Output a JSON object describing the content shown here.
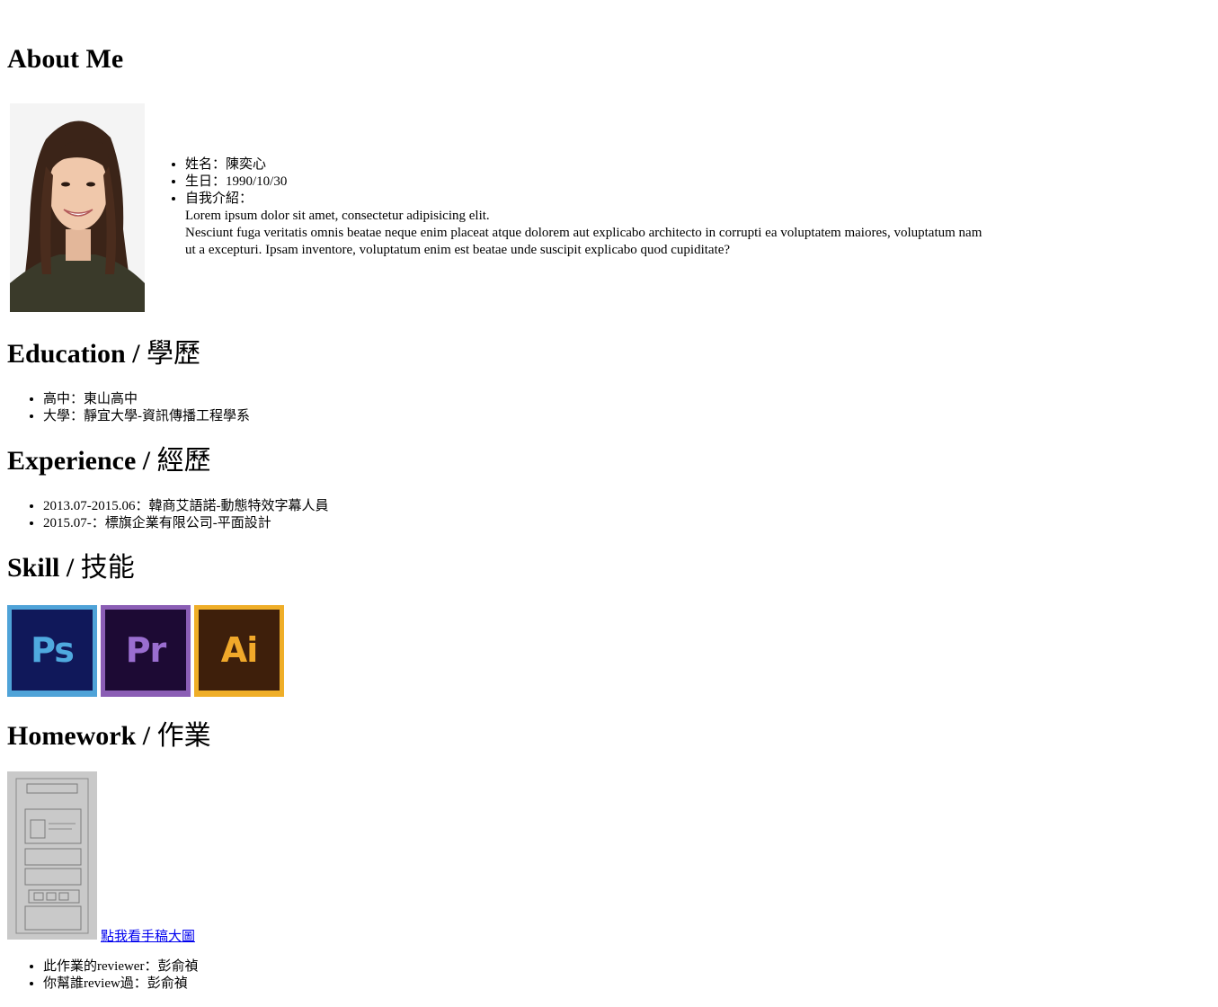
{
  "about": {
    "heading": "About Me",
    "items": {
      "name": "姓名：陳奕心",
      "birthday": "生日：1990/10/30",
      "intro_label": "自我介紹：",
      "intro_line1": "Lorem ipsum dolor sit amet, consectetur adipisicing elit.",
      "intro_line2": "Nesciunt fuga veritatis omnis beatae neque enim placeat atque dolorem aut explicabo architecto in corrupti ea voluptatem maiores, voluptatum nam ut a excepturi. Ipsam inventore, voluptatum enim est beatae unde suscipit explicabo quod cupiditate?"
    }
  },
  "education": {
    "heading_en": "Education / ",
    "heading_zh": "學歷",
    "items": [
      "高中：東山高中",
      "大學：靜宜大學-資訊傳播工程學系"
    ]
  },
  "experience": {
    "heading_en": "Experience / ",
    "heading_zh": "經歷",
    "items": [
      "2013.07-2015.06：韓商艾語諾-動態特效字幕人員",
      "2015.07-：標旗企業有限公司-平面設計"
    ]
  },
  "skill": {
    "heading_en": "Skill / ",
    "heading_zh": "技能",
    "icons": [
      {
        "label": "Ps",
        "icon": "photoshop-icon",
        "border": "#4fa3d8",
        "bg": "#10185a",
        "text": "#4fa9df"
      },
      {
        "label": "Pr",
        "icon": "premiere-icon",
        "border": "#8b5eb5",
        "bg": "#1d0a34",
        "text": "#9a6ed0"
      },
      {
        "label": "Ai",
        "icon": "illustrator-icon",
        "border": "#efae28",
        "bg": "#3e1f0b",
        "text": "#f0a82a"
      }
    ]
  },
  "homework": {
    "heading_en": "Homework / ",
    "heading_zh": "作業",
    "link_text": "點我看手稿大圖",
    "items": [
      "此作業的reviewer：彭俞禎",
      "你幫誰review過：彭俞禎"
    ]
  },
  "colors": {
    "link": "#0000ee",
    "text": "#000000",
    "background": "#ffffff"
  }
}
